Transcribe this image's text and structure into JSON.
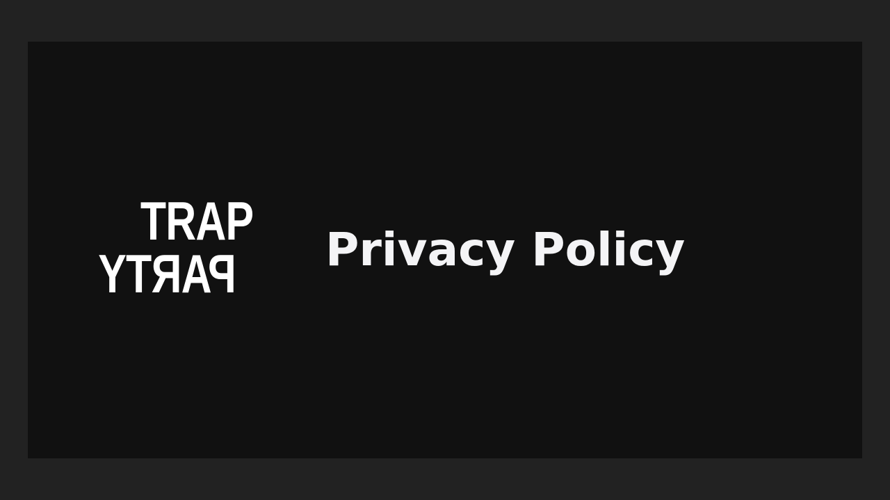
{
  "brand": {
    "logo_line_1": "TRAP",
    "logo_line_2": "PARTY"
  },
  "page": {
    "title": "Privacy Policy"
  },
  "colors": {
    "outer_background": "#222222",
    "card_background": "#111111",
    "text": "#f4f4f6"
  }
}
